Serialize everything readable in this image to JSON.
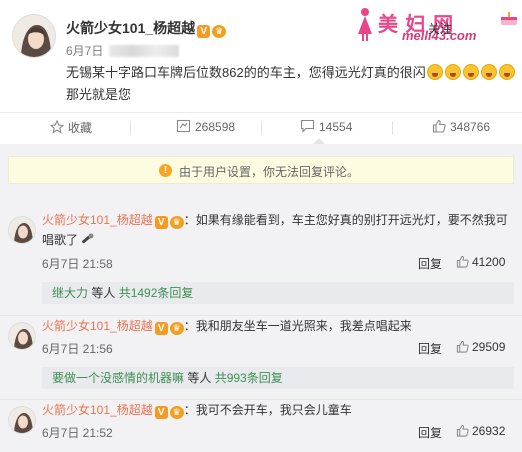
{
  "post": {
    "author": "火箭少女101_杨超越",
    "date": "6月7日",
    "text_before": "无锡某十字路口车牌后位数862的的车主，您得远光灯真的很闪",
    "text_after": "那光就是您",
    "follow_label": "关注"
  },
  "watermark": {
    "title": "美 妇 网",
    "url": "meili43.com"
  },
  "actions": {
    "favorite": "收藏",
    "repost_count": "268598",
    "comment_count": "14554",
    "like_count": "348766"
  },
  "notice": "由于用户设置，你无法回复评论。",
  "comments": [
    {
      "author": "火箭少女101_杨超越",
      "text": "：如果有缘能看到，车主您好真的别打开远光灯，要不然我可唱歌了",
      "time": "6月7日 21:58",
      "reply_label": "回复",
      "likes": "41200",
      "sub_user": "继大力",
      "sub_mid": " 等人 ",
      "sub_count": "共1492条回复"
    },
    {
      "author": "火箭少女101_杨超越",
      "text": "：我和朋友坐车一道光照来，我差点唱起来",
      "time": "6月7日 21:56",
      "reply_label": "回复",
      "likes": "29509",
      "sub_user": "要做一个没感情的机器嘛",
      "sub_mid": " 等人 ",
      "sub_count": "共993条回复"
    },
    {
      "author": "火箭少女101_杨超越",
      "text": "：我可不会开车，我只会儿童车",
      "time": "6月7日 21:52",
      "reply_label": "回复",
      "likes": "26932"
    }
  ],
  "colors": {
    "link": "#eb7350",
    "sub_link": "#3e8e52",
    "notice_bg": "#fdfce0",
    "badge": "#f59a23"
  }
}
